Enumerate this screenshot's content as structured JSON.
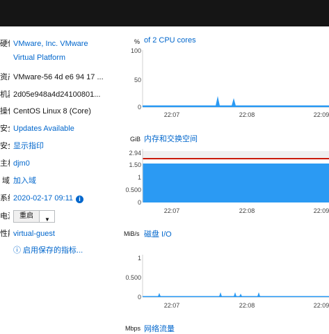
{
  "details": [
    {
      "label": "硬件",
      "value": "VMware, Inc. VMware",
      "value2": "Virtual Platform",
      "link": true
    },
    {
      "label": "资产标记",
      "value": "VMware-56 4d e6 94 17 ...",
      "link": false
    },
    {
      "label": "机器编号",
      "value": "2d05e948a4d24100801...",
      "link": false
    },
    {
      "label": "操作系统",
      "value": "CentOS Linux 8 (Core)",
      "link": false
    },
    {
      "label": "安全更新",
      "value": "Updates Available",
      "link": true
    },
    {
      "label": "安全外壳密钥",
      "value": "显示指印",
      "link": true
    },
    {
      "label": "主机名",
      "value": "djm0",
      "link": true
    },
    {
      "label": "域",
      "value": "加入域",
      "link": true
    },
    {
      "label": "系统时间",
      "value": "2020-02-17 09:11",
      "link": true
    },
    {
      "label": "电源选项",
      "value": "重启"
    },
    {
      "label": "性能配置集",
      "value": "virtual-guest",
      "link": true
    }
  ],
  "enable_metrics": "ⓘ 启用保存的指标...",
  "power_caret_icon": "chevron-down-icon",
  "time_icon": "info-icon",
  "charts": {
    "cpu": {
      "unit": "%",
      "title": "of 2 CPU cores",
      "ticks": [
        "100",
        "50",
        "0"
      ],
      "xticks": [
        "22:07",
        "22:08",
        "22:09"
      ]
    },
    "mem": {
      "unit": "GiB",
      "title": "内存和交换空间",
      "ticks": [
        "2.94",
        "1.50",
        "1",
        "0.500",
        "0"
      ],
      "xticks": [
        "22:07",
        "22:08",
        "22:09"
      ]
    },
    "disk": {
      "unit": "MiB/s",
      "title": "磁盘 I/O",
      "ticks": [
        "1",
        "0.500",
        "0"
      ],
      "xticks": [
        "22:07",
        "22:08",
        "22:09"
      ]
    },
    "net": {
      "unit": "Mbps",
      "title": "网络流量"
    }
  },
  "colors": {
    "accent": "#0066cc",
    "fill": "#2b9af3",
    "line": "#c9190b",
    "topbar": "#151515"
  }
}
